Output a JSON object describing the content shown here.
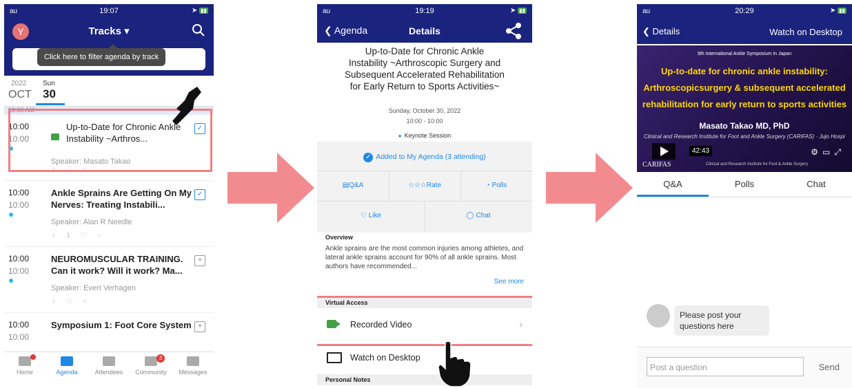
{
  "panel1": {
    "status": {
      "carrier": "au",
      "time": "19:07"
    },
    "avatar_letter": "Y",
    "nav_title": "Tracks ▾",
    "tooltip": "Click here to filter agenda by track",
    "date": {
      "year": "2022",
      "month": "OCT",
      "weekday": "Sun",
      "day": "30"
    },
    "time_header": "10:00 AM",
    "sessions": [
      {
        "start": "10:00",
        "end": "10:00",
        "title": "Up-to-Date for Chronic Ankle Instability ~Arthros...",
        "speaker": "Speaker: Masato Takao",
        "icons": "♀ ♡ ○"
      },
      {
        "start": "10:00",
        "end": "10:00",
        "title": "Ankle Sprains Are Getting On My Nerves: Treating Instabili...",
        "speaker": "Speaker: Alan R Needle",
        "icons": "♀ 1 ♡ ○"
      },
      {
        "start": "10:00",
        "end": "10:00",
        "title": "NEUROMUSCULAR TRAINING. Can it work? Will it work? Ma...",
        "speaker": "Speaker: Evert Verhagen",
        "icons": "♀ ♡ ○"
      },
      {
        "start": "10:00",
        "end": "10:00",
        "title": "Symposium 1: Foot Core System",
        "speaker": "",
        "icons": ""
      }
    ],
    "tabs": [
      {
        "label": "Home"
      },
      {
        "label": "Agenda"
      },
      {
        "label": "Attendees"
      },
      {
        "label": "Community",
        "badge": "3"
      },
      {
        "label": "Messages"
      }
    ]
  },
  "panel2": {
    "status": {
      "carrier": "au",
      "time": "19:19"
    },
    "back_label": "Agenda",
    "nav_title": "Details",
    "title": "Up-to-Date for Chronic Ankle Instability ~Arthroscopic Surgery and Subsequent Accelerated Rehabilitation for Early Return to Sports Activities~",
    "date": "Sunday, October 30, 2022",
    "time": "10:00 - 10:00",
    "type": "Keynote Session",
    "added": "Added to My Agenda (3 attending)",
    "actions": {
      "qa": "Q&A",
      "rate": "Rate",
      "polls": "Polls",
      "like": "Like",
      "chat": "Chat"
    },
    "overview_heading": "Overview",
    "overview": "Ankle sprains are the most common injuries among athletes, and lateral ankle sprains account for 90% of all ankle sprains. Most authors have recommended...",
    "see_more": "See more",
    "virtual_access": "Virtual Access",
    "recorded_video": "Recorded Video",
    "watch_desktop": "Watch on Desktop",
    "personal_notes": "Personal Notes"
  },
  "panel3": {
    "status": {
      "carrier": "au",
      "time": "20:29"
    },
    "back_label": "Details",
    "right_label": "Watch on Desktop",
    "video": {
      "symposium": "9th International Ankle Symposium in Japan",
      "line1": "Up-to-date for chronic ankle instability:",
      "line2": "Arthroscopicsurgery & subsequent accelerated",
      "line3": "rehabilitation for early return to sports activities",
      "speaker": "Masato Takao MD, PhD",
      "institute": "Clinical and Research Institute for Foot and Ankle Surgery (CARIFAS)",
      "hospital": "Jujo Hospital, Kisarazu, Japan",
      "timestamp": "42:43",
      "logo": "CARIFAS",
      "logo_sub": "Clinical and Research Institute for Foot & Ankle Surgery"
    },
    "tabs": [
      "Q&A",
      "Polls",
      "Chat"
    ],
    "message": "Please post your questions here",
    "input_placeholder": "Post a question",
    "send": "Send"
  },
  "colors": {
    "nav": "#1a237e",
    "accent": "#1e88e5",
    "highlight": "#ee7f84",
    "video_green": "#43a047"
  }
}
